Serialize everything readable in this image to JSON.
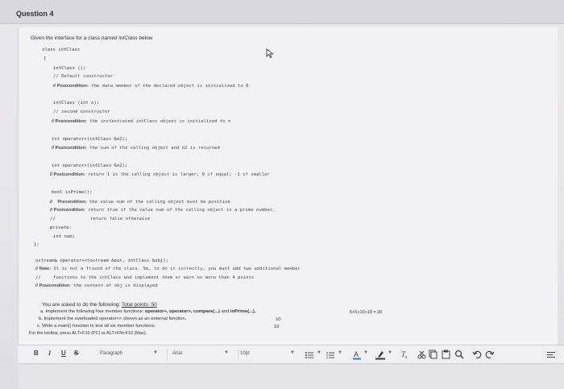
{
  "question": {
    "title": "Question 4"
  },
  "intro": {
    "prefix": "Given the interface for a class named ",
    "class_name": "intClass",
    "suffix": " below"
  },
  "code": {
    "l1": "class intClass",
    "l2": "{",
    "l3": "intClass ();",
    "l4": "// Default constructor",
    "l5_label": "// Postcondition:",
    "l5_text": " the data member of the declared object is initialized to 0",
    "l6": "intClass (int n);",
    "l7": "// second constructor",
    "l8_label": "// Postcondition:",
    "l8_text": " the instantiated intClass object is initialized to n",
    "l9": "int operator+(intClass &n2);",
    "l10_label": "// Postcondition:",
    "l10_text": " the sum of the calling object and n2 is returned",
    "l11": "int operator>(intClass &n2);",
    "l12_label": "// Postcondition:",
    "l12_text": " return 1 is the calling object is larger; 0 if equal; -1 if smaller",
    "l13": "bool isPrime();",
    "l14_label": "//    Precondition:",
    "l14_text": " the value num of the calling object must be positive",
    "l15_label": "// Postcondition:",
    "l15_text": " return true if the value num of the calling object is a prime number,",
    "l16a": "//",
    "l16b": "return false otherwise",
    "l17": "private:",
    "l18": "int num;",
    "l19": "};",
    "l20": "ostream& operator<<(ostream &out, intClass &obj);",
    "l21_label": "// Note:",
    "l21_text": " It is not a friend of the class. So, to do it correctly, you must add two additional member",
    "l22a": "//",
    "l22b": "functions to the intClass and implement them or earn no more than 4 points",
    "l23_label": "// Postcondition:",
    "l23_text": " the content of obj is displayed"
  },
  "task": {
    "l1": "You are asked to do the following: ",
    "l1_u": "Total points: 50",
    "l2a": "a. Implement the following four member functions: ",
    "l2b": "operator+, operator>, compare(...)",
    "l2c": " and ",
    "l2d": "inPrime(...).",
    "l2e": "5+5+10+10 = 30",
    "l3": "b. Implement the overloaded operator<< shown as an external function.",
    "l3pts": "10",
    "l4": "c. Write a main() function to test all six member functions.",
    "l4pts": "10",
    "l5": "For the toolbar, press ALT+F10 (PC) or ALT+FN+F10 (Mac)."
  },
  "toolbar": {
    "bold": "B",
    "italic": "I",
    "underline": "U",
    "strike": "S",
    "paragraph": "Paragraph",
    "font": "Arial",
    "size": "10pt"
  }
}
